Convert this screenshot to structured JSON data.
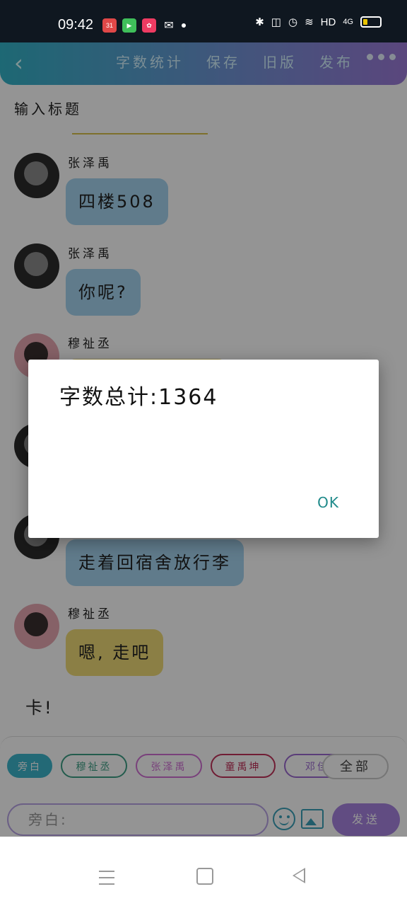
{
  "status_bar": {
    "time": "09:42",
    "app_badge": "31",
    "network": "HD",
    "signal": "4G"
  },
  "top_nav": {
    "word_count": "字数统计",
    "save": "保存",
    "old_version": "旧版",
    "publish": "发布"
  },
  "title_placeholder": "输入标题",
  "messages": [
    {
      "sender": "张泽禹",
      "text": "四楼508"
    },
    {
      "sender": "张泽禹",
      "text": "你呢?"
    },
    {
      "sender": "穆祉丞",
      "text": ""
    },
    {
      "sender": "",
      "text": ""
    },
    {
      "sender": "",
      "text": "走着回宿舍放行李"
    },
    {
      "sender": "穆祉丞",
      "text": "嗯, 走吧"
    }
  ],
  "narration": "卡!",
  "characters": [
    "旁白",
    "穆祉丞",
    "张泽禹",
    "童禹坤",
    "邓佳"
  ],
  "all_button": "全部",
  "input": {
    "placeholder": "旁白:"
  },
  "send_button": "发送",
  "dialog": {
    "message": "字数总计:1364",
    "ok": "OK"
  },
  "colors": {
    "header_start": "#33b3c8",
    "header_end": "#9c7ad8",
    "bubble_blue": "#a6d5ef",
    "bubble_yellow": "#f0db78",
    "send": "#a784e1",
    "ok_text": "#1f8a8a"
  }
}
